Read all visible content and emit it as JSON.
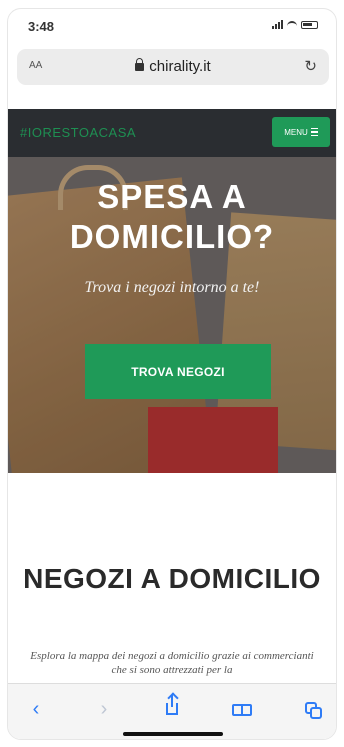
{
  "status_bar": {
    "time": "3:48"
  },
  "browser": {
    "text_size_label": "AA",
    "host": "chirality.it"
  },
  "site_nav": {
    "brand": "#IORESTOACASA",
    "menu_label": "MENU"
  },
  "hero": {
    "title": "SPESA A DOMICILIO?",
    "subtitle": "Trova i negozi intorno a te!",
    "cta_label": "TROVA NEGOZI"
  },
  "section": {
    "title": "NEGOZI A DOMICILIO",
    "description": "Esplora la mappa dei negozi a domicilio grazie ai commercianti che si sono attrezzati per la"
  },
  "colors": {
    "accent": "#1f9a58",
    "nav_bg": "#2a2d31",
    "ios_blue": "#2f7cf6"
  },
  "toolbar": {
    "icons": [
      "back-icon",
      "forward-icon",
      "share-icon",
      "bookmarks-icon",
      "tabs-icon"
    ]
  }
}
